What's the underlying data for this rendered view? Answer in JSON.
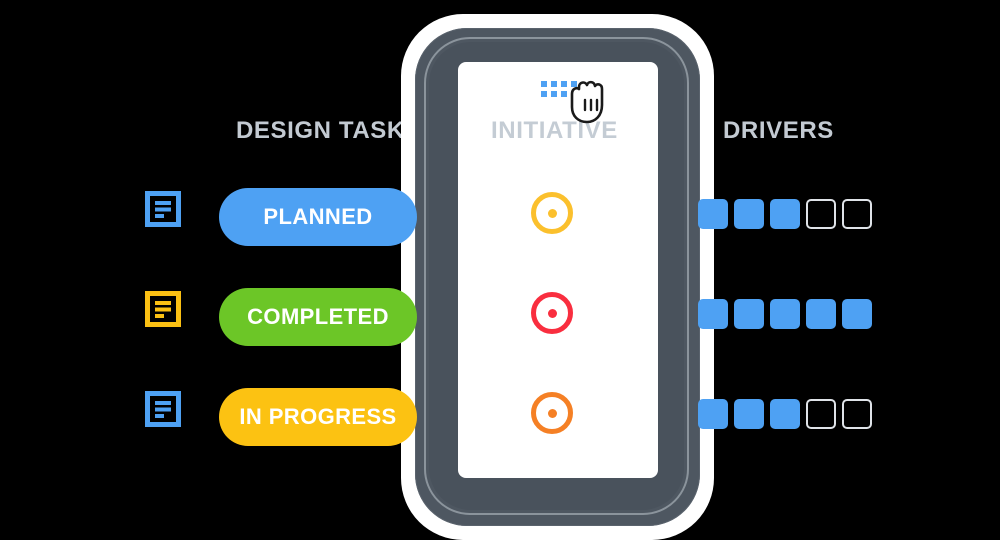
{
  "columns": {
    "design_tasks": "DESIGN TASKS",
    "initiative": "INITIATIVE",
    "drivers": "DRIVERS"
  },
  "device": {
    "bezel_color": "#4e5761",
    "screen_color": "#ffffff",
    "glow_color": "#ffffff",
    "ring_color": "#8b949c"
  },
  "cursor": {
    "icon": "grab-hand-icon",
    "motion_dot_color": "#4ea1f3",
    "motion_dot_rows": 2,
    "motion_dot_cols": 4
  },
  "rows": [
    {
      "doc_icon": "document-lines-icon",
      "doc_icon_color": "#4ea1f3",
      "status_label": "PLANNED",
      "status_color": "#4ea1f3",
      "target_icon": "target-circle-icon",
      "target_color": "#fbc02d",
      "drivers_filled": 3,
      "drivers_total": 5
    },
    {
      "doc_icon": "document-lines-icon",
      "doc_icon_color": "#fbc013",
      "status_label": "COMPLETED",
      "status_color": "#6cc627",
      "target_icon": "target-circle-icon",
      "target_color": "#f92e3f",
      "drivers_filled": 5,
      "drivers_total": 5
    },
    {
      "doc_icon": "document-lines-icon",
      "doc_icon_color": "#4ea1f3",
      "status_label": "IN PROGRESS",
      "status_color": "#fcc212",
      "target_icon": "target-circle-icon",
      "target_color": "#f58025",
      "drivers_filled": 3,
      "drivers_total": 5
    }
  ],
  "palette": {
    "heading": "#c3cad2",
    "blue": "#4ea1f3",
    "green": "#6cc627",
    "yellow": "#fcc212",
    "red": "#f92e3f",
    "orange": "#f58025",
    "background": "#000000",
    "empty_square_border": "#dfe3e8"
  }
}
